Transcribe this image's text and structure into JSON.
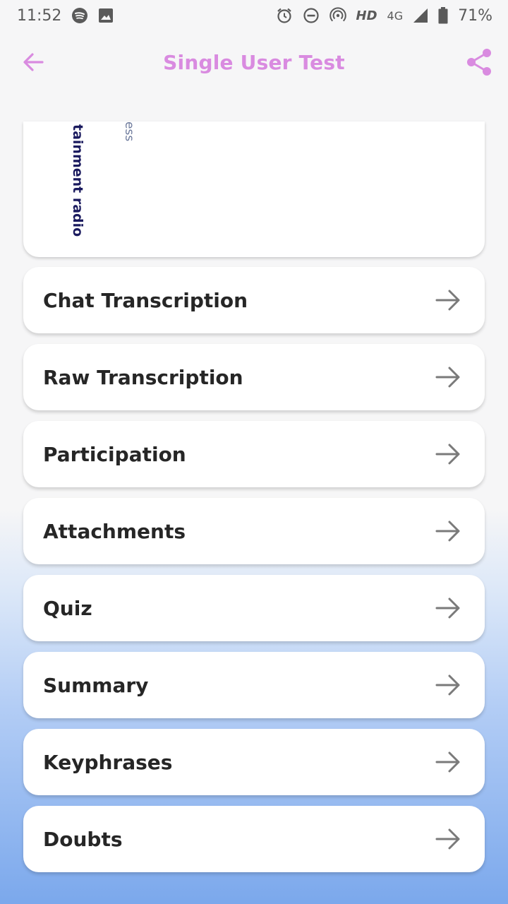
{
  "status_bar": {
    "time": "11:52",
    "hd": "HD",
    "network": "4G",
    "battery_percent": "71%",
    "icons": [
      "spotify-icon",
      "image-icon",
      "alarm-icon",
      "dnd-icon",
      "hotspot-icon",
      "signal-icon",
      "battery-icon"
    ]
  },
  "app_bar": {
    "title": "Single User Test",
    "accent_color": "#d98be0",
    "back_icon": "arrow-left-icon",
    "share_icon": "share-icon"
  },
  "top_card": {
    "text_primary": "tainment radio",
    "text_secondary": "ess"
  },
  "menu": {
    "items": [
      {
        "label": "Chat Transcription"
      },
      {
        "label": "Raw Transcription"
      },
      {
        "label": "Participation"
      },
      {
        "label": "Attachments"
      },
      {
        "label": "Quiz"
      },
      {
        "label": "Summary"
      },
      {
        "label": "Keyphrases"
      },
      {
        "label": "Doubts"
      }
    ],
    "arrow_icon": "arrow-right-icon"
  }
}
